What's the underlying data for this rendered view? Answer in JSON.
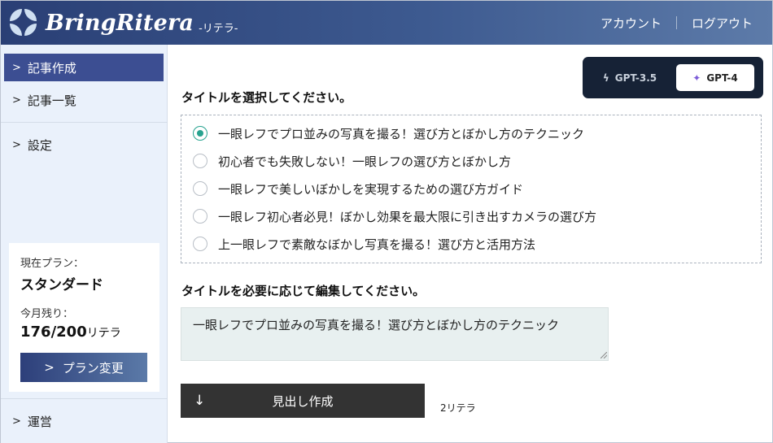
{
  "header": {
    "logo_text": "BringRitera",
    "logo_sub": "-リテラ-",
    "account_label": "アカウント",
    "logout_label": "ログアウト",
    "colors": {
      "gradient_start": "#2a3f75",
      "gradient_end": "#5d7ba9"
    }
  },
  "sidebar": {
    "items": [
      {
        "label": "記事作成",
        "active": true
      },
      {
        "label": "記事一覧",
        "active": false
      },
      {
        "label": "設定",
        "active": false
      },
      {
        "label": "運営",
        "active": false
      }
    ],
    "chevron": ">",
    "plan": {
      "current_label": "現在プラン：",
      "name": "スタンダード",
      "remaining_label": "今月残り：",
      "remaining_value": "176/200",
      "remaining_unit": "リテラ",
      "change_button": "プラン変更"
    }
  },
  "model_toggle": {
    "options": [
      {
        "label": "GPT-3.5",
        "icon": "bolt-icon",
        "selected": false
      },
      {
        "label": "GPT-4",
        "icon": "sparkle-icon",
        "selected": true
      }
    ]
  },
  "main": {
    "select_title_label": "タイトルを選択してください。",
    "titles": [
      {
        "text": "一眼レフでプロ並みの写真を撮る！選び方とぼかし方のテクニック",
        "checked": true
      },
      {
        "text": "初心者でも失敗しない！一眼レフの選び方とぼかし方",
        "checked": false
      },
      {
        "text": "一眼レフで美しいぼかしを実現するための選び方ガイド",
        "checked": false
      },
      {
        "text": "一眼レフ初心者必見！ぼかし効果を最大限に引き出すカメラの選び方",
        "checked": false
      },
      {
        "text": "上一眼レフで素敵なぼかし写真を撮る！選び方と活用方法",
        "checked": false
      }
    ],
    "edit_title_label": "タイトルを必要に応じて編集してください。",
    "edit_value": "一眼レフでプロ並みの写真を撮る！選び方とぼかし方のテクニック",
    "generate_button": "見出し作成",
    "generate_arrow": "↓",
    "cost": "2リテラ",
    "accent_color": "#27a38f"
  }
}
